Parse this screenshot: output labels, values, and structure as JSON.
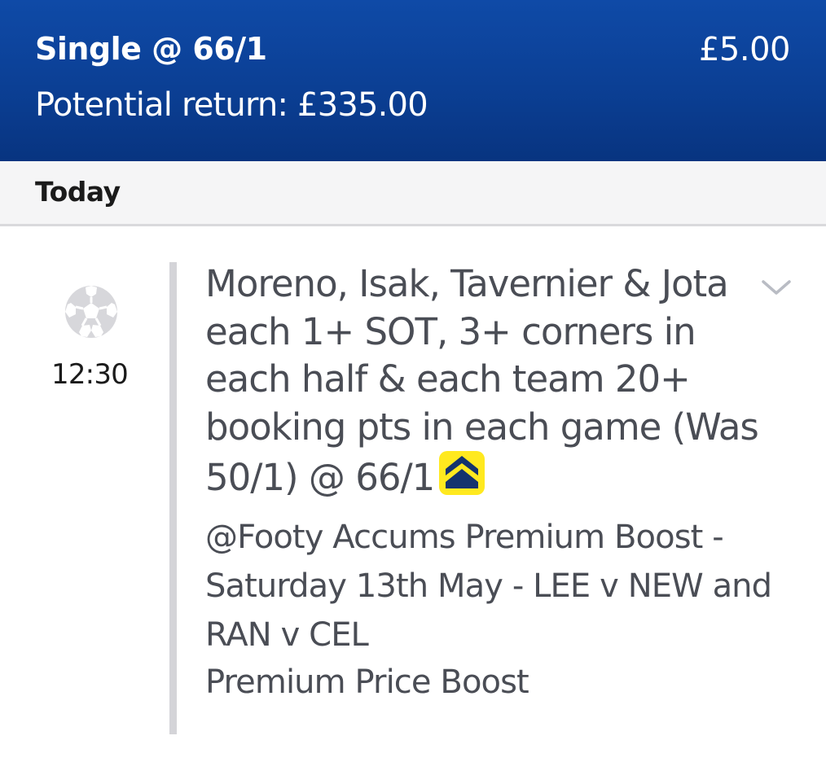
{
  "header": {
    "bet_type": "Single @ 66/1",
    "stake": "£5.00",
    "potential_return": "Potential return: £335.00",
    "gradient_top": "#0f4aa7",
    "gradient_bottom": "#083480"
  },
  "day": {
    "label": "Today"
  },
  "bet": {
    "sport_icon": "football-icon",
    "time": "12:30",
    "selection": "Moreno, Isak, Tavernier & Jota each 1+ SOT, 3+ corners in each half & each team 20+ booking pts in each game (Was 50/1) @ 66/1",
    "boost_icon": "price-boost-icon",
    "boost_color": "#ffe91f",
    "expand_icon": "chevron-down-icon",
    "market": "@Footy Accums Premium Boost - Saturday 13th May - LEE v NEW and RAN v CEL",
    "promo": "Premium Price Boost"
  }
}
